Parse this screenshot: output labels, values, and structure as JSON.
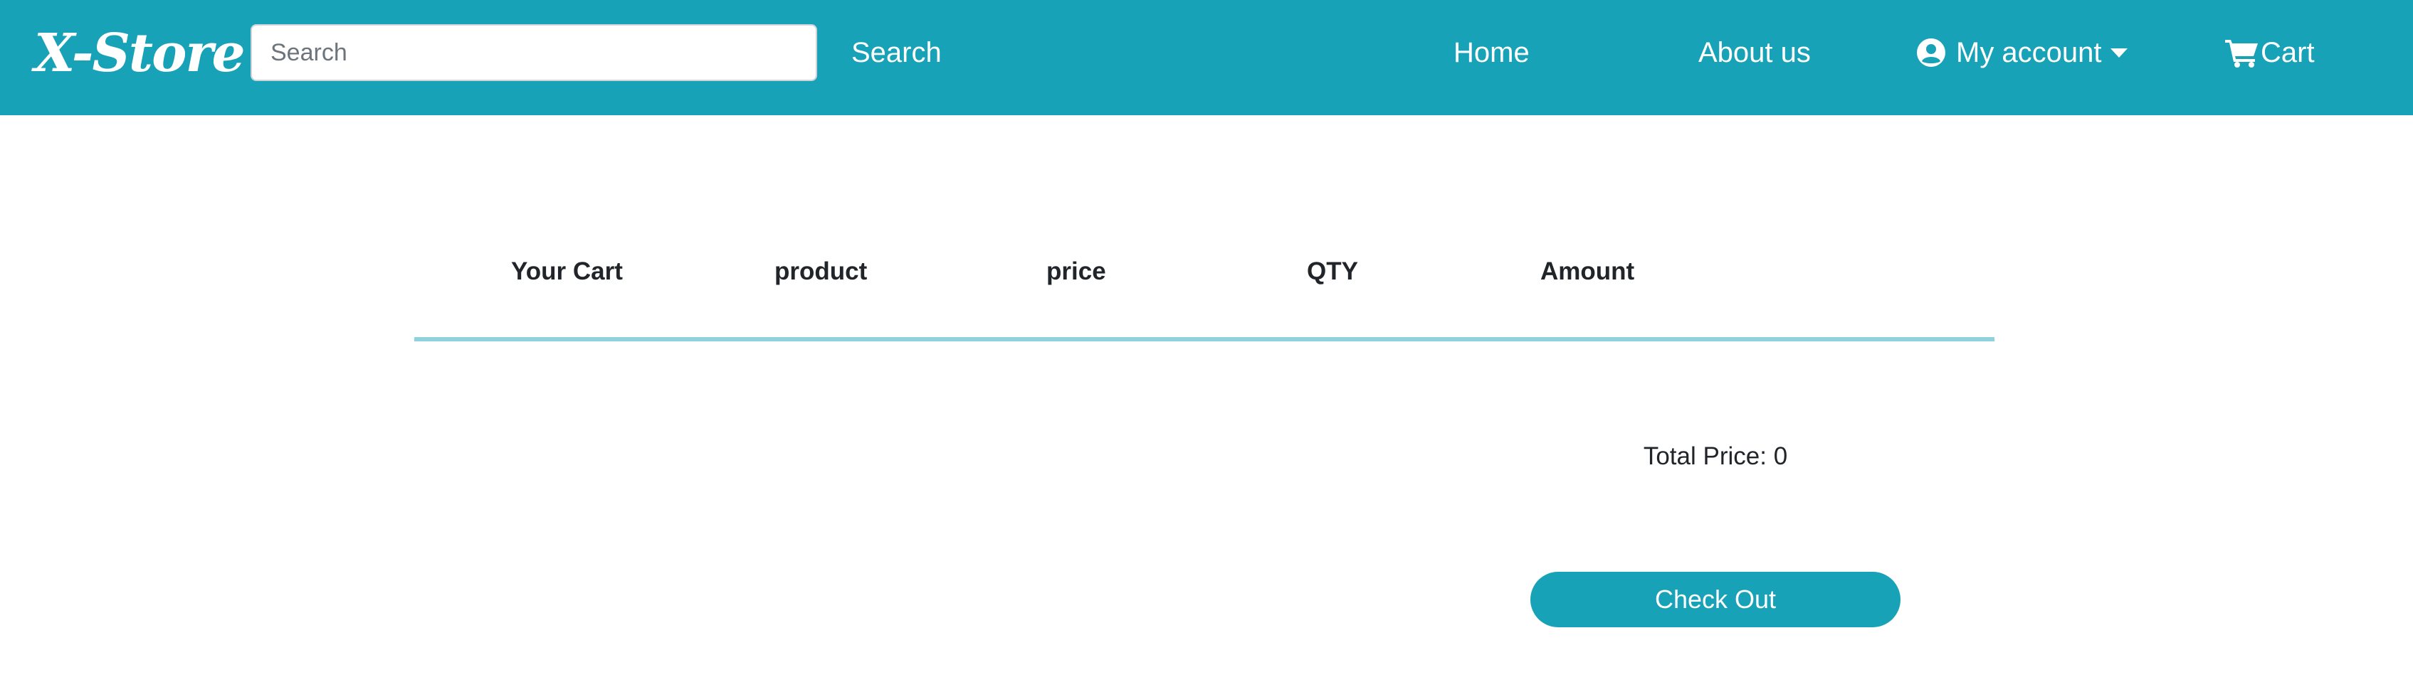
{
  "navbar": {
    "brand": "X-Store",
    "search": {
      "placeholder": "Search",
      "value": "",
      "button_label": "Search"
    },
    "links": {
      "home": "Home",
      "about": "About us",
      "account": "My account",
      "cart": "Cart"
    },
    "icons": {
      "account": "user-circle-icon",
      "account_dropdown": "caret-down-icon",
      "cart": "shopping-cart-icon"
    },
    "colors": {
      "background": "#17a2b8",
      "text": "#ffffff"
    }
  },
  "cart_table": {
    "headers": [
      "Your Cart",
      "product",
      "price",
      "QTY",
      "Amount"
    ],
    "rows": [],
    "divider_color": "#8fd1dc"
  },
  "summary": {
    "total_label": "Total Price: 0",
    "checkout_label": "Check Out",
    "checkout_color": "#17a2b8"
  }
}
